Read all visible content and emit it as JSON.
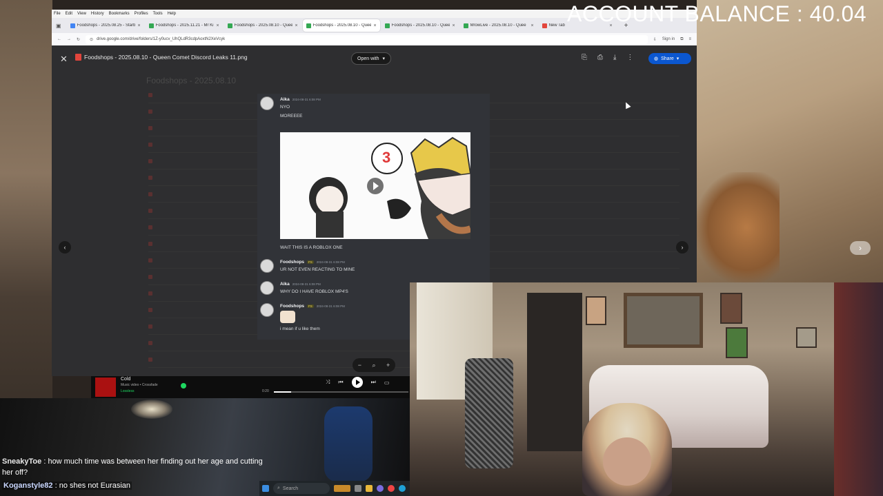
{
  "overlay": {
    "balance": "ACCOUNT BALANCE : 40.04"
  },
  "browser": {
    "menu": [
      "File",
      "Edit",
      "View",
      "History",
      "Bookmarks",
      "Profiles",
      "Tools",
      "Help"
    ],
    "tabs": [
      {
        "label": "Foodshops - 2025.08.25 - Starb",
        "color": "#4285f4",
        "active": false
      },
      {
        "label": "Foodshops - 2025.11.21 - Mr Ki",
        "color": "#34a853",
        "active": false
      },
      {
        "label": "Foodshops - 2025.08.10 - Quee",
        "color": "#34a853",
        "active": false
      },
      {
        "label": "Foodshops - 2025.08.10 - Quee",
        "color": "#34a853",
        "active": true
      },
      {
        "label": "Foodshops - 2025.08.10 - Quee",
        "color": "#34a853",
        "active": false
      },
      {
        "label": "MrowLive - 2025.08.10 - Quee",
        "color": "#34a853",
        "active": false
      },
      {
        "label": "New Tab",
        "color": "#e2453c",
        "active": false
      }
    ],
    "url": "drive.google.com/drive/folders/1Z-y0ucv_UhQLdR3cdpAoxtN2XeVcyk",
    "sign_in": "Sign in"
  },
  "viewer": {
    "file_title": "Foodshops - 2025.08.10 - Queen Comet Discord Leaks 11.png",
    "open_with": "Open with",
    "share": "Share",
    "bg_title": "Foodshops - 2025.08.10"
  },
  "discord": {
    "messages": [
      {
        "user": "Aika",
        "tag": "",
        "time": "2024-08-31 6:08 PM",
        "lines": [
          "NYO",
          "MOREEEE"
        ]
      },
      {
        "user": "",
        "tag": "",
        "time": "",
        "lines": [
          "WAIT THIS IS A ROBLOX ONE"
        ]
      },
      {
        "user": "Foodshops",
        "tag": "FS",
        "time": "2024-08-31 6:08 PM",
        "lines": [
          "UR NOT EVEN REACTING TO MINE"
        ]
      },
      {
        "user": "Aika",
        "tag": "",
        "time": "2024-08-31 6:08 PM",
        "lines": [
          "WHY DO I HAVE ROBLOX MP4'S"
        ]
      },
      {
        "user": "Foodshops",
        "tag": "FS",
        "time": "2024-08-31 6:08 PM",
        "lines": [
          "i mean if u like them"
        ]
      }
    ],
    "embed_number": "3"
  },
  "music": {
    "title": "Cold",
    "subtitle": "Music video • Crossfade",
    "quality": "Lossless",
    "elapsed": "0:20",
    "progress": 0.13
  },
  "chat": {
    "line1_user": "SneakyToe",
    "line1_text": " : how much time was between her finding out her age and cutting her off?",
    "line2_user": "Koganstyle82",
    "line2_text": " : no shes not Eurasian"
  },
  "taskbar": {
    "search": "Search"
  }
}
